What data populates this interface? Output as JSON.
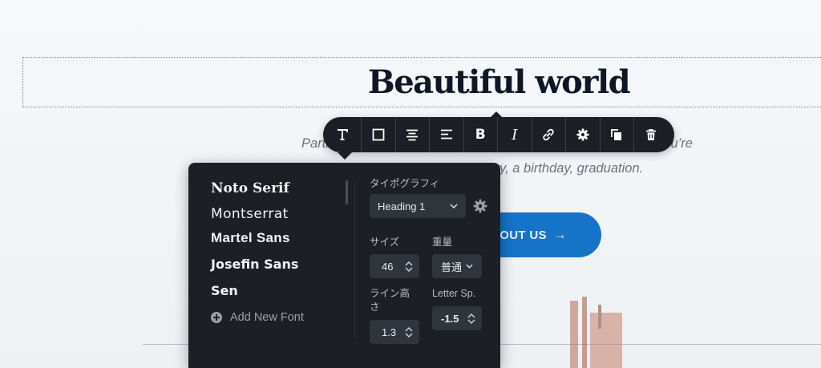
{
  "page": {
    "heading": "Beautiful world",
    "subtitle_line1": "Parties and family gatherings are popular no matter whether you’re",
    "subtitle_line2": "celebrating an anniversary, a birthday, graduation.",
    "cta_label": "MORE ABOUT US",
    "cta_arrow": "→"
  },
  "toolbar": {
    "items": [
      {
        "name": "typography",
        "icon": "text-T-icon"
      },
      {
        "name": "box",
        "icon": "square-icon"
      },
      {
        "name": "align-center",
        "icon": "align-center-icon"
      },
      {
        "name": "align-left",
        "icon": "align-left-icon"
      },
      {
        "name": "bold",
        "icon": "bold-icon",
        "glyph": "B"
      },
      {
        "name": "italic",
        "icon": "italic-icon",
        "glyph": "I"
      },
      {
        "name": "link",
        "icon": "link-icon"
      },
      {
        "name": "settings",
        "icon": "gear-icon"
      },
      {
        "name": "duplicate",
        "icon": "copy-icon"
      },
      {
        "name": "delete",
        "icon": "trash-icon"
      }
    ]
  },
  "typography_panel": {
    "fonts": [
      "Noto Serif",
      "Montserrat",
      "Martel Sans",
      "Josefin Sans",
      "Sen"
    ],
    "add_font_label": "Add New Font",
    "typography_label": "タイポグラフィ",
    "preset_value": "Heading 1",
    "size_label": "サイズ",
    "size_value": "46",
    "weight_label": "重量",
    "weight_value": "普通",
    "line_height_label": "ライン高さ",
    "line_height_value": "1.3",
    "letter_spacing_label": "Letter Sp.",
    "letter_spacing_value": "-1.5"
  },
  "colors": {
    "panel_bg": "#1c1f25",
    "accent": "#1573c8",
    "heading": "#0f1724"
  }
}
